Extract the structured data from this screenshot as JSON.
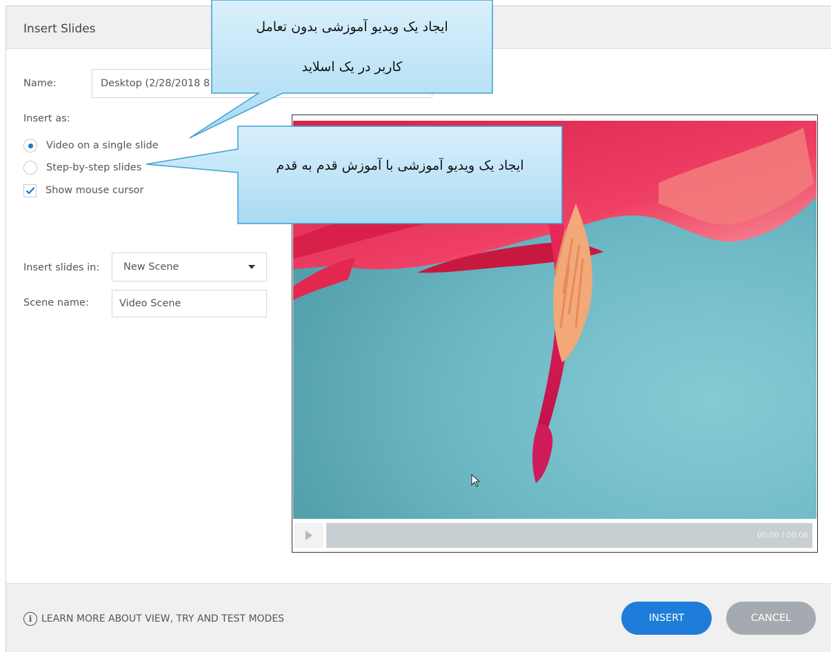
{
  "dialog": {
    "title": "Insert Slides",
    "name_label": "Name:",
    "name_value": "Desktop (2/28/2018 8",
    "insert_as_label": "Insert as:",
    "insert_as_options": [
      {
        "label": "Video on a single slide",
        "selected": true
      },
      {
        "label": "Step-by-step slides",
        "selected": false
      }
    ],
    "show_cursor_label": "Show mouse cursor",
    "show_cursor_checked": true,
    "insert_in_label": "Insert slides in:",
    "insert_in_value": "New Scene",
    "scene_name_label": "Scene name:",
    "scene_name_value": "Video Scene"
  },
  "player": {
    "time": "00:00 / 00:06"
  },
  "footer": {
    "learn_more": "LEARN MORE ABOUT VIEW, TRY AND TEST MODES",
    "insert_label": "INSERT",
    "cancel_label": "CANCEL"
  },
  "callouts": [
    {
      "lines": [
        "ایجاد یک ویدیو آموزشی بدون تعامل",
        "کاربر در یک اسلاید"
      ]
    },
    {
      "lines": [
        "ایجاد یک ویدیو آموزشی با آموزش قدم به قدم"
      ]
    }
  ],
  "colors": {
    "accent": "#1e7dd8",
    "cancel": "#a4aaaf",
    "callout_fill": "#bde4f7",
    "callout_border": "#3c9ed6"
  }
}
